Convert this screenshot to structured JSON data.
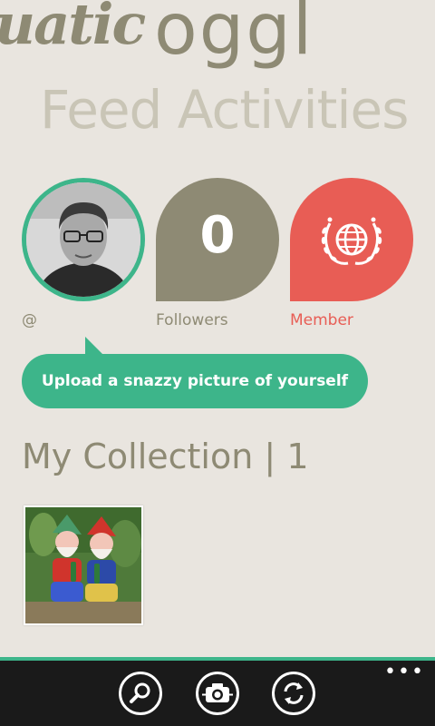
{
  "app": {
    "brand_script": "uatic",
    "brand_logo": "oggl"
  },
  "pivot": {
    "title": "Feed Activities"
  },
  "profile": {
    "handle": "@",
    "followers_count": "0",
    "followers_label": "Followers",
    "member_label": "Member",
    "member_icon": "globe-laurel-icon",
    "upload_prompt": "Upload a snazzy picture of yourself"
  },
  "collection": {
    "heading": "My Collection",
    "separator": "|",
    "count": "1"
  },
  "appbar": {
    "buttons": [
      {
        "icon": "search-icon"
      },
      {
        "icon": "camera-icon"
      },
      {
        "icon": "refresh-icon"
      }
    ],
    "more_label": "•••"
  },
  "colors": {
    "background": "#e9e5df",
    "brand_khaki": "#8e8a74",
    "accent_green": "#3db58a",
    "member_red": "#e85d55",
    "appbar": "#1a1a1a"
  }
}
